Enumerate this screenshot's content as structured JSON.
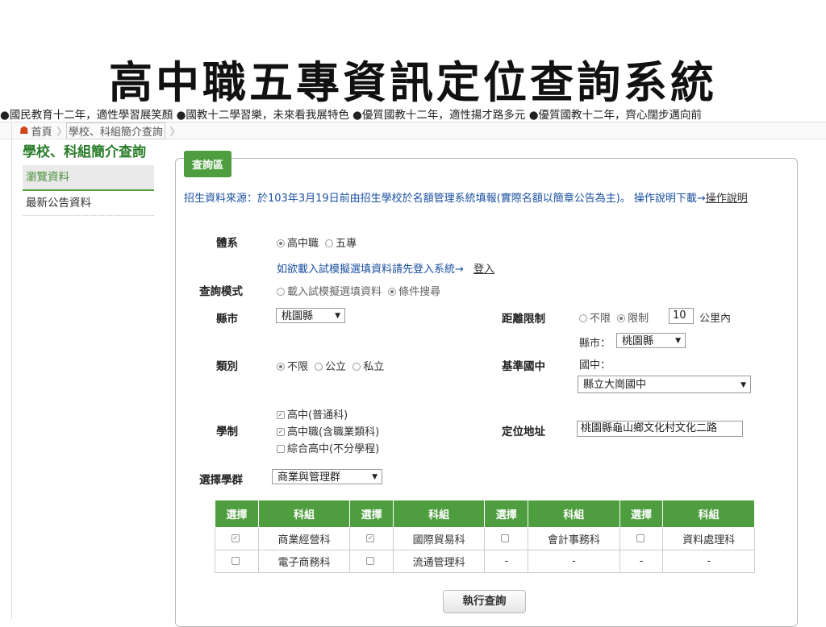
{
  "slide_title": "高中職五專資訊定位查詢系統",
  "marquee": "●國民教育十二年，適性學習展笑顏 ●國教十二學習樂，未來看我展特色 ●優質國教十二年，適性揚才路多元 ●優質國教十二年，齊心闊步邁向前",
  "breadcrumb": {
    "home": "首頁",
    "current": "學校、科組簡介查詢"
  },
  "sidebar": {
    "title": "學校、科組簡介查詢",
    "items": [
      {
        "label": "瀏覽資料",
        "active": true
      },
      {
        "label": "最新公告資料",
        "active": false
      }
    ]
  },
  "panel": {
    "tab_label": "查詢區",
    "notice_text": "招生資料來源：於103年3月19日前由招生學校於名額管理系統填報(實際名額以簡章公告為主)。 操作說明下載→",
    "notice_link": "操作說明",
    "system": {
      "label": "體系",
      "options": [
        "高中職",
        "五專"
      ],
      "selected": "高中職"
    },
    "login_prompt": "如欲載入試模擬選填資料請先登入系統→",
    "login_link": "登入",
    "query_mode": {
      "label": "查詢模式",
      "options": [
        "載入試模擬選填資料",
        "條件搜尋"
      ],
      "selected": "條件搜尋"
    },
    "county": {
      "label": "縣市",
      "value": "桃園縣"
    },
    "distance": {
      "label": "距離限制",
      "options": [
        "不限",
        "限制"
      ],
      "selected": "限制",
      "value": "10",
      "unit": "公里內"
    },
    "category": {
      "label": "類別",
      "options": [
        "不限",
        "公立",
        "私立"
      ],
      "selected": "不限"
    },
    "base_school": {
      "label": "基準國中",
      "county_label": "縣市：",
      "county_value": "桃園縣",
      "school_label": "國中：",
      "school_value": "縣立大崗國中"
    },
    "school_system": {
      "label": "學制",
      "options": [
        {
          "label": "高中(普通科)",
          "checked": true
        },
        {
          "label": "高中職(含職業類科)",
          "checked": true
        },
        {
          "label": "綜合高中(不分學程)",
          "checked": false
        }
      ]
    },
    "address": {
      "label": "定位地址",
      "value": "桃園縣龜山鄉文化村文化二路"
    },
    "group": {
      "label": "選擇學群",
      "value": "商業與管理群"
    },
    "table": {
      "headers": [
        "選擇",
        "科組",
        "選擇",
        "科組",
        "選擇",
        "科組",
        "選擇",
        "科組"
      ],
      "rows": [
        [
          {
            "type": "cb",
            "checked": true
          },
          "商業經營科",
          {
            "type": "cb",
            "checked": true
          },
          "國際貿易科",
          {
            "type": "cb",
            "checked": false
          },
          "會計事務科",
          {
            "type": "cb",
            "checked": false
          },
          "資料處理科"
        ],
        [
          {
            "type": "cb",
            "checked": false
          },
          "電子商務科",
          {
            "type": "cb",
            "checked": false
          },
          "流通管理科",
          "-",
          "-",
          "-",
          "-"
        ]
      ]
    },
    "run_button": "執行查詢"
  }
}
